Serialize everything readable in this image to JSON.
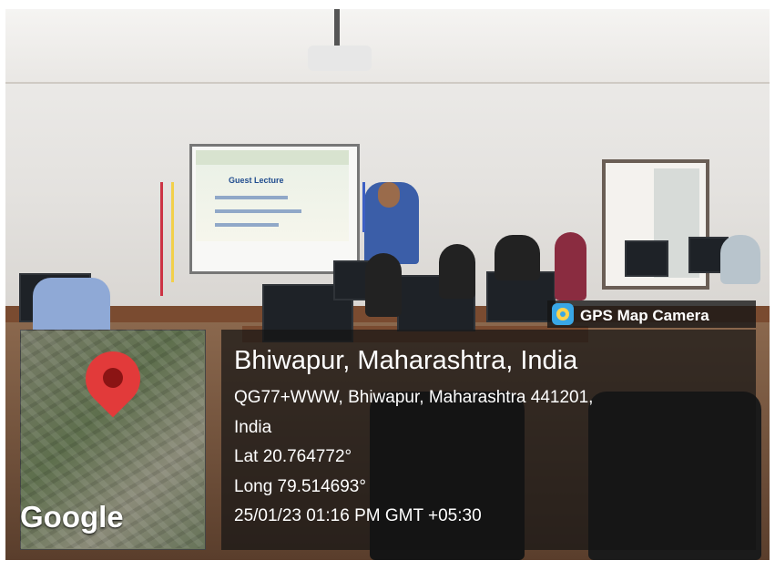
{
  "badge": {
    "label": "GPS Map Camera",
    "icon": "gps-map-camera-icon"
  },
  "location": {
    "title": "Bhiwapur, Maharashtra, India",
    "address_line_1": "QG77+WWW, Bhiwapur, Maharashtra 441201,",
    "address_line_2": "India",
    "lat": "Lat 20.764772°",
    "long": "Long 79.514693°",
    "datetime": "25/01/23 01:16 PM GMT +05:30"
  },
  "map": {
    "brand": "Google",
    "marker": "map-marker-icon"
  },
  "slide": {
    "title": "Guest Lecture"
  },
  "colors": {
    "overlay": "#141414",
    "marker": "#e23a3a",
    "badge_icon": "#39a7e6"
  }
}
